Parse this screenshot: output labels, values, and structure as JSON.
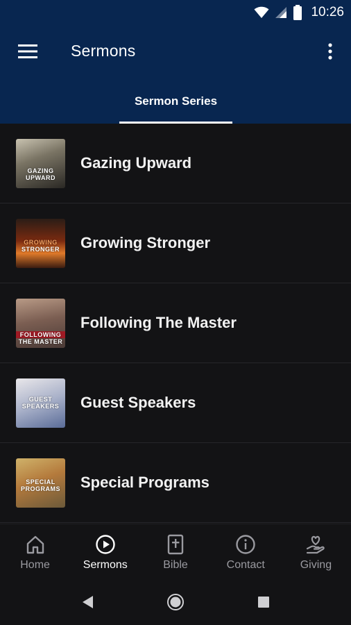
{
  "status": {
    "time": "10:26",
    "icons": [
      "wifi-icon",
      "signal-icon",
      "battery-icon"
    ]
  },
  "appbar": {
    "title": "Sermons",
    "menu_icon": "hamburger-menu-icon",
    "more_icon": "more-vert-icon",
    "background": "#082650"
  },
  "tabs": [
    {
      "label": "Sermon Series",
      "selected": true
    }
  ],
  "series": [
    {
      "title": "Gazing Upward",
      "thumb_text": [
        "GAZING",
        "UPWARD"
      ]
    },
    {
      "title": "Growing Stronger",
      "thumb_text": [
        "GROWING",
        "STRONGER"
      ]
    },
    {
      "title": "Following The Master",
      "thumb_text": [
        "FOLLOWING",
        "THE MASTER"
      ]
    },
    {
      "title": "Guest Speakers",
      "thumb_text": [
        "GUEST",
        "SPEAKERS"
      ]
    },
    {
      "title": "Special Programs",
      "thumb_text": [
        "SPECIAL",
        "PROGRAMS"
      ]
    }
  ],
  "bottom_nav": [
    {
      "label": "Home",
      "icon": "home-icon",
      "active": false
    },
    {
      "label": "Sermons",
      "icon": "play-circle-icon",
      "active": true
    },
    {
      "label": "Bible",
      "icon": "bible-icon",
      "active": false
    },
    {
      "label": "Contact",
      "icon": "info-icon",
      "active": false
    },
    {
      "label": "Giving",
      "icon": "giving-heart-hand-icon",
      "active": false
    }
  ],
  "system_nav": [
    "back-icon",
    "home-circle-icon",
    "recents-square-icon"
  ]
}
